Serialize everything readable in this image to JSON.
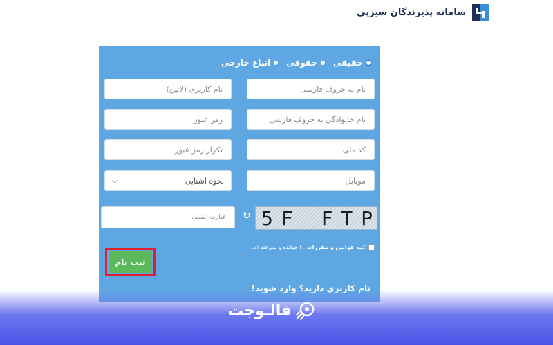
{
  "header": {
    "title": "سامانه پذیرندگان سیزپی",
    "logo_icon": "brand-logo-icon"
  },
  "form": {
    "person_types": [
      {
        "label": "حقیقی",
        "selected": true
      },
      {
        "label": "حقوقی",
        "selected": false
      },
      {
        "label": "اتباع خارجی",
        "selected": false
      }
    ],
    "fields": {
      "first_name_placeholder": "نام به حروف فارسی",
      "username_placeholder": "نام کاربری (لاتین)",
      "last_name_placeholder": "نام خانوادگی به حروف فارسی",
      "password_placeholder": "رمز عبور",
      "national_code_placeholder": "کد ملی",
      "confirm_password_placeholder": "تکرار رمز عبور",
      "mobile_placeholder": "موبایل",
      "referral_select": "نحوه آشنایی",
      "captcha_placeholder": "عبارت امنیتی"
    },
    "captcha": {
      "text": "5F FTP",
      "refresh_icon": "refresh-icon"
    },
    "terms": {
      "prefix": "کلیه",
      "link": "قوانین و مقررات",
      "suffix": "را خوانده و پذیرفته ام."
    },
    "submit_label": "ثبت نام",
    "login_link": "نام کاربری دارید؟ وارد شوید!"
  },
  "branding": {
    "text": "فالـوجت"
  },
  "colors": {
    "panel": "#5ea7e2",
    "submit": "#5cb85c",
    "highlight": "#e01e2d",
    "band": "#4a52e6"
  }
}
